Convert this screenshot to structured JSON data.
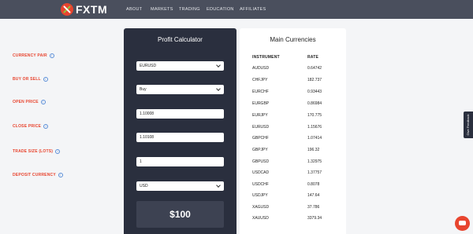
{
  "brand": {
    "name": "FXTM"
  },
  "nav": [
    "ABOUT",
    "MARKETS",
    "TRADING",
    "EDUCATION",
    "AFFILIATES"
  ],
  "calculator": {
    "title": "Profit Calculator",
    "fields": [
      {
        "label": "CURRENCY PAIR",
        "value": "EURUSD",
        "type": "select"
      },
      {
        "label": "BUY OR SELL",
        "value": "Buy",
        "type": "select"
      },
      {
        "label": "OPEN PRICE",
        "value": "1.10008",
        "type": "input"
      },
      {
        "label": "CLOSE PRICE",
        "value": "1.10108",
        "type": "input"
      },
      {
        "label": "TRADE SIZE (LOTS)",
        "value": "1",
        "type": "input"
      },
      {
        "label": "DEPOSIT CURRENCY",
        "value": "USD",
        "type": "select"
      }
    ],
    "info_glyph": "i",
    "result": "$100"
  },
  "currencies": {
    "title": "Main Currencies",
    "headers": [
      "INSTRUMENT",
      "RATE"
    ],
    "rows": [
      [
        "AUDUSD",
        "0.64742"
      ],
      [
        "CHFJPY",
        "182.737"
      ],
      [
        "EURCHF",
        "0.93443"
      ],
      [
        "EURGBP",
        "0.86984"
      ],
      [
        "EURJPY",
        "170.775"
      ],
      [
        "EURUSD",
        "1.15676"
      ],
      [
        "GBPCHF",
        "1.07414"
      ],
      [
        "GBPJPY",
        "196.32"
      ],
      [
        "GBPUSD",
        "1.32975"
      ],
      [
        "USDCAD",
        "1.37757"
      ],
      [
        "USDCHF",
        "0.8078"
      ],
      [
        "USDJPY",
        "147.64"
      ],
      [
        "XAGUSD",
        "37.786"
      ],
      [
        "XAUUSD",
        "3379.34"
      ]
    ]
  },
  "feedback": {
    "label": "Give Feedback"
  },
  "icons": {
    "chat": "chat-icon",
    "chevron": "chevron-down-icon",
    "info": "info-icon"
  },
  "colors": {
    "accent": "#e8452f",
    "panel": "#2a2f3e",
    "topbar": "#4a4f5d"
  }
}
